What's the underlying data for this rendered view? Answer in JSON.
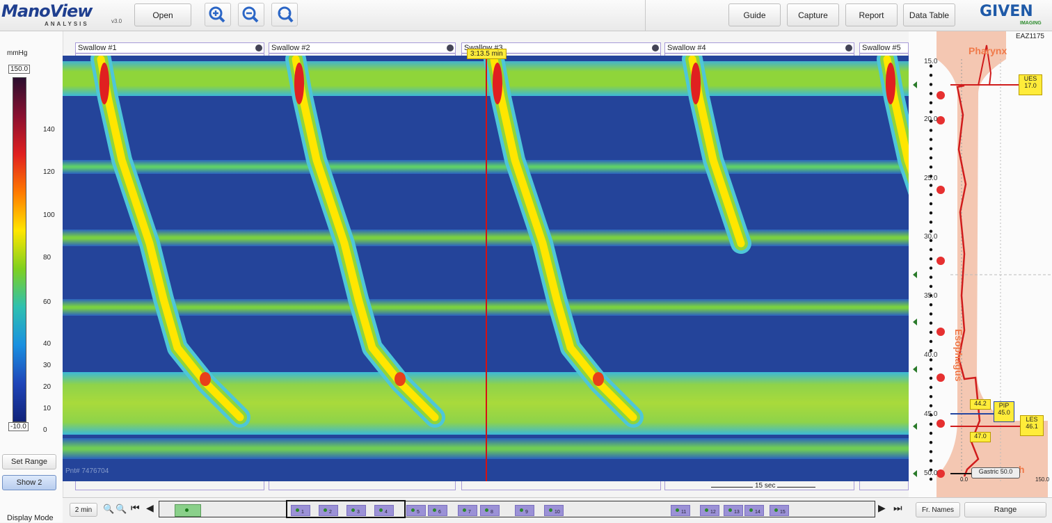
{
  "app": {
    "logo": "ManoView",
    "logo_sub": "ANALYSIS",
    "version": "v3.0",
    "vendor": "GIVEN",
    "vendor_sub": "IMAGING",
    "patient_code": "EAZ1175"
  },
  "toolbar": {
    "open_label": "Open",
    "guide_label": "Guide",
    "capture_label": "Capture",
    "report_label": "Report",
    "data_table_label": "Data Table",
    "zoom_in_icon": "zoom-in-icon",
    "zoom_out_icon": "zoom-out-icon",
    "zoom_fit_icon": "zoom-fit-icon"
  },
  "colorbar": {
    "unit": "mmHg",
    "max_label": "150.0",
    "min_label": "-10.0",
    "ticks": [
      "140",
      "120",
      "100",
      "80",
      "60",
      "40",
      "30",
      "20",
      "10",
      "0"
    ],
    "colors": [
      "#2b0f2f",
      "#8a1030",
      "#e02020",
      "#ff7a00",
      "#ffe600",
      "#7fd020",
      "#2fc0b0",
      "#1a90e0",
      "#1f45b8",
      "#11237a"
    ]
  },
  "left_panel": {
    "set_range_label": "Set Range",
    "show_label": "Show 2",
    "display_mode_label": "Display Mode"
  },
  "swallows": [
    {
      "label": "Swallow #1"
    },
    {
      "label": "Swallow #2"
    },
    {
      "label": "Swallow #3"
    },
    {
      "label": "Swallow #4"
    },
    {
      "label": "Swallow #5"
    }
  ],
  "cursor_time": "3:13.5 min",
  "scale_bar_label": "15 sec",
  "watermark": "Pnt# 7476704",
  "anatomy": {
    "pharynx_label": "Pharynx",
    "esophagus_label": "Esophagus",
    "stomach_label": "h",
    "depths": [
      "15.0",
      "20.0",
      "25.0",
      "30.0",
      "35.0",
      "40.0",
      "45.0",
      "50.0"
    ],
    "x_min": "0.0",
    "x_max": "150.0",
    "markers": [
      {
        "label": "UES",
        "value": "17.0"
      },
      {
        "label": "PIP",
        "value": "45.0"
      },
      {
        "label": "LES",
        "value": "46.1"
      },
      {
        "label": "",
        "value": "44.2"
      },
      {
        "label": "",
        "value": "47.0"
      },
      {
        "label": "Gastric",
        "value": "50.0"
      }
    ]
  },
  "bottom": {
    "time_window": "2 min",
    "fr_names_label": "Fr. Names",
    "range_label": "Range",
    "chip_numbers": [
      "1",
      "2",
      "3",
      "4",
      "5",
      "6",
      "7",
      "8",
      "9",
      "10",
      "11",
      "12",
      "13",
      "14",
      "15"
    ]
  },
  "colors": {
    "trace": "#d01c1c",
    "highlight": "#ffec3a",
    "accent": "#6f8fc4",
    "anatomy_fill": "#f4c7b2",
    "label_orange": "#f07a4a"
  }
}
